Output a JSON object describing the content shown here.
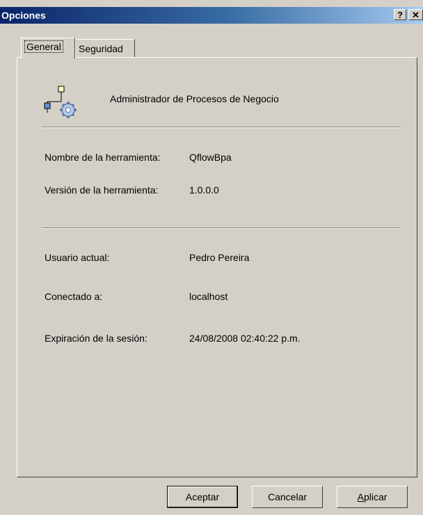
{
  "window": {
    "title": "Opciones",
    "help_label": "?",
    "close_label": "✕"
  },
  "tabs": [
    {
      "label": "General"
    },
    {
      "label": "Seguridad"
    }
  ],
  "header": {
    "icon": "process-gear-icon",
    "title": "Administrador de Procesos de Negocio"
  },
  "tool_info": [
    {
      "label": "Nombre de la herramienta:",
      "value": "QflowBpa"
    },
    {
      "label": "Versión de la herramienta:",
      "value": "1.0.0.0"
    }
  ],
  "session_info": [
    {
      "label": "Usuario actual:",
      "value": "Pedro Pereira"
    },
    {
      "label": "Conectado a:",
      "value": "localhost"
    },
    {
      "label": "Expiración de la sesión:",
      "value": "24/08/2008 02:40:22 p.m."
    }
  ],
  "buttons": {
    "ok": "Aceptar",
    "cancel": "Cancelar",
    "apply_mnemonic": "A",
    "apply_rest": "plicar"
  }
}
